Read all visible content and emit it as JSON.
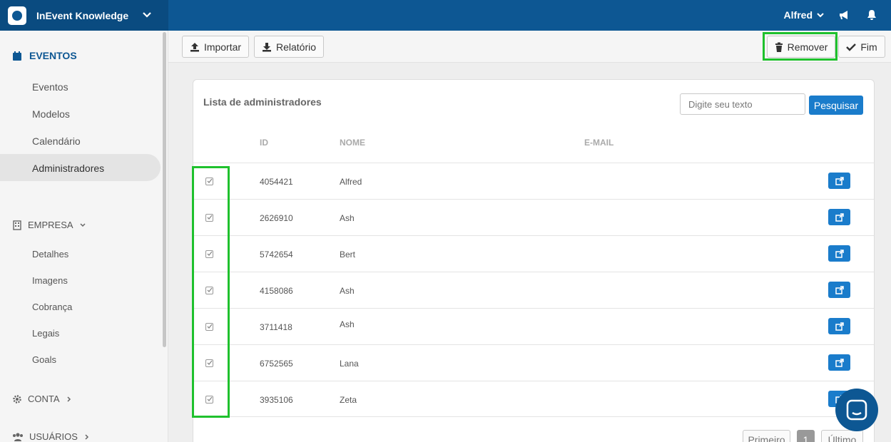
{
  "topbar": {
    "app_title": "InEvent Knowledge",
    "user_name": "Alfred",
    "icons": [
      "chevron-down-icon",
      "megaphone-icon",
      "bell-icon"
    ]
  },
  "sidebar": {
    "main_section": "EVENTOS",
    "main_items": [
      {
        "label": "Eventos"
      },
      {
        "label": "Modelos"
      },
      {
        "label": "Calendário"
      },
      {
        "label": "Administradores",
        "active": true
      }
    ],
    "empresa_section": "EMPRESA",
    "empresa_items": [
      {
        "label": "Detalhes"
      },
      {
        "label": "Imagens"
      },
      {
        "label": "Cobrança"
      },
      {
        "label": "Legais"
      },
      {
        "label": "Goals"
      }
    ],
    "conta_section": "CONTA",
    "usuarios_section": "USUÁRIOS"
  },
  "toolbar": {
    "import_label": "Importar",
    "report_label": "Relatório",
    "remove_label": "Remover",
    "end_label": "Fim"
  },
  "card": {
    "title": "Lista de administradores",
    "search_placeholder": "Digite seu texto",
    "search_button": "Pesquisar",
    "columns": [
      "ID",
      "NOME",
      "E-MAIL"
    ],
    "rows": [
      {
        "id": "4054421",
        "name": "Alfred",
        "email": "",
        "checked": true
      },
      {
        "id": "2626910",
        "name": "Ash",
        "email": "",
        "checked": true
      },
      {
        "id": "5742654",
        "name": "Bert",
        "email": "",
        "checked": true
      },
      {
        "id": "4158086",
        "name": "Ash",
        "email": "",
        "checked": true
      },
      {
        "id": "3711418",
        "name": "Ash",
        "email": "",
        "checked": true
      },
      {
        "id": "6752565",
        "name": "Lana",
        "email": "",
        "checked": true
      },
      {
        "id": "3935106",
        "name": "Zeta",
        "email": "",
        "checked": true
      }
    ],
    "pagination": {
      "first": "Primeiro",
      "current": "1",
      "last": "Último"
    }
  },
  "colors": {
    "topbar": "#0d5793",
    "accent": "#1a7ccb",
    "highlight": "#1fc12d"
  }
}
